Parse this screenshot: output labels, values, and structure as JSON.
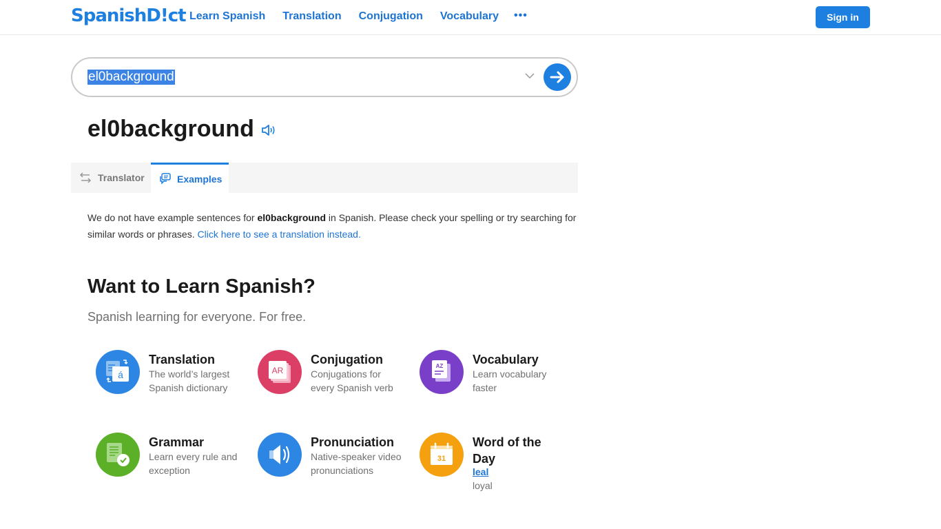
{
  "header": {
    "logo": "SpanishD!ct",
    "nav": [
      "Learn Spanish",
      "Translation",
      "Conjugation",
      "Vocabulary"
    ],
    "more_label": "•••",
    "signin_label": "Sign in"
  },
  "search": {
    "value": "el0background",
    "icons": [
      "chevron-down-icon",
      "arrow-right-icon"
    ]
  },
  "headword": {
    "text": "el0background",
    "audio_icon": "speaker-icon"
  },
  "tabs": [
    {
      "label": "Translator",
      "icon": "swap-arrows-icon",
      "active": false
    },
    {
      "label": "Examples",
      "icon": "chat-bubbles-icon",
      "active": true
    }
  ],
  "message": {
    "prefix": "We do not have example sentences for ",
    "term": "el0background",
    "suffix": " in Spanish. Please check your spelling or try searching for similar words or phrases. ",
    "link": "Click here to see a translation instead."
  },
  "learn": {
    "title": "Want to Learn Spanish?",
    "subtitle": "Spanish learning for everyone. For free.",
    "cards": [
      {
        "title": "Translation",
        "desc": "The world’s largest Spanish dictionary",
        "color": "#2d86e3",
        "icon": "translation-icon"
      },
      {
        "title": "Conjugation",
        "desc": "Conjugations for every Spanish verb",
        "color": "#dc3f66",
        "icon": "conjugation-ar-icon",
        "icon_text": "AR"
      },
      {
        "title": "Vocabulary",
        "desc": "Learn vocabulary faster",
        "color": "#7a3fc8",
        "icon": "vocabulary-az-icon",
        "icon_text": "AZ"
      },
      {
        "title": "Grammar",
        "desc": "Learn every rule and exception",
        "color": "#5bb028",
        "icon": "grammar-check-icon"
      },
      {
        "title": "Pronunciation",
        "desc": "Native-speaker video pronunciations",
        "color": "#2d86e3",
        "icon": "speaker-icon"
      },
      {
        "title": "Word of the Day",
        "word": "leal",
        "translation": "loyal",
        "color": "#f5a00f",
        "icon": "calendar-icon",
        "icon_text": "31"
      }
    ]
  },
  "colors": {
    "brand": "#1d7fe0",
    "link": "#1d74d4"
  }
}
